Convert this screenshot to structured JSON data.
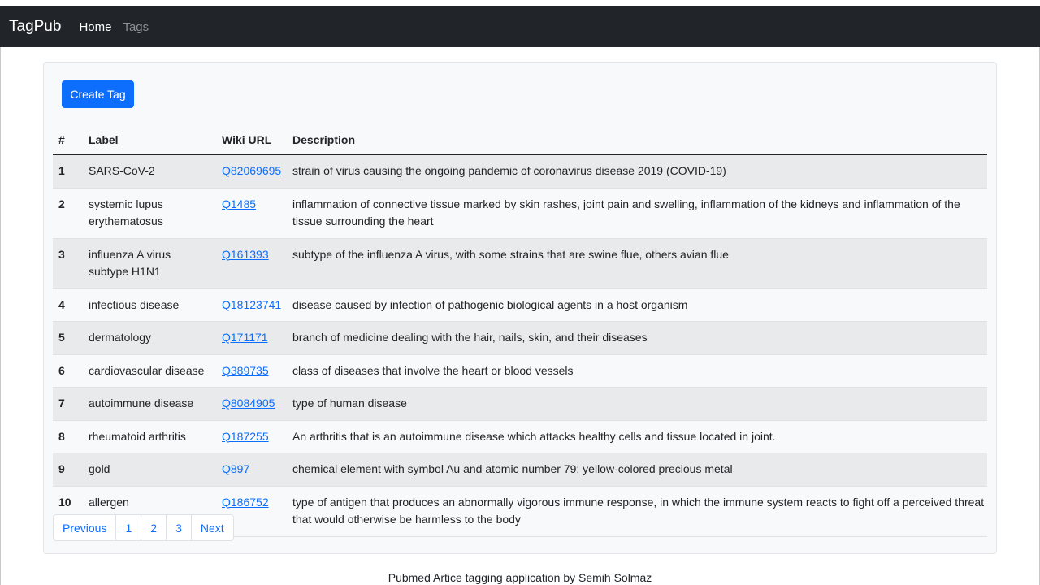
{
  "navbar": {
    "brand": "TagPub",
    "links": [
      {
        "label": "Home"
      },
      {
        "label": "Tags"
      }
    ]
  },
  "actions": {
    "create_tag_label": "Create Tag"
  },
  "table": {
    "headers": [
      "#",
      "Label",
      "Wiki URL",
      "Description"
    ],
    "rows": [
      {
        "num": "1",
        "label": "SARS-CoV-2",
        "wiki": "Q82069695",
        "description": "strain of virus causing the ongoing pandemic of coronavirus disease 2019 (COVID-19)"
      },
      {
        "num": "2",
        "label": "systemic lupus erythematosus",
        "wiki": "Q1485",
        "description": "inflammation of connective tissue marked by skin rashes, joint pain and swelling, inflammation of the kidneys and inflammation of the tissue surrounding the heart"
      },
      {
        "num": "3",
        "label": "influenza A virus subtype H1N1",
        "wiki": "Q161393",
        "description": "subtype of the influenza A virus, with some strains that are swine flue, others avian flue"
      },
      {
        "num": "4",
        "label": "infectious disease",
        "wiki": "Q18123741",
        "description": "disease caused by infection of pathogenic biological agents in a host organism"
      },
      {
        "num": "5",
        "label": "dermatology",
        "wiki": "Q171171",
        "description": "branch of medicine dealing with the hair, nails, skin, and their diseases"
      },
      {
        "num": "6",
        "label": "cardiovascular disease",
        "wiki": "Q389735",
        "description": "class of diseases that involve the heart or blood vessels"
      },
      {
        "num": "7",
        "label": "autoimmune disease",
        "wiki": "Q8084905",
        "description": "type of human disease"
      },
      {
        "num": "8",
        "label": "rheumatoid arthritis",
        "wiki": "Q187255",
        "description": "An arthritis that is an autoimmune disease which attacks healthy cells and tissue located in joint."
      },
      {
        "num": "9",
        "label": "gold",
        "wiki": "Q897",
        "description": "chemical element with symbol Au and atomic number 79; yellow-colored precious metal"
      },
      {
        "num": "10",
        "label": "allergen",
        "wiki": "Q186752",
        "description": "type of antigen that produces an abnormally vigorous immune response, in which the immune system reacts to fight off a perceived threat that would otherwise be harmless to the body"
      }
    ]
  },
  "pagination": {
    "previous_label": "Previous",
    "pages": [
      "1",
      "2",
      "3"
    ],
    "next_label": "Next"
  },
  "footer": {
    "text": "Pubmed Artice tagging application by Semih Solmaz"
  },
  "colors": {
    "navbar_bg": "#212529",
    "primary": "#0d6efd",
    "card_bg": "#f8f9fa",
    "striped_row": "#e9eaeb"
  }
}
